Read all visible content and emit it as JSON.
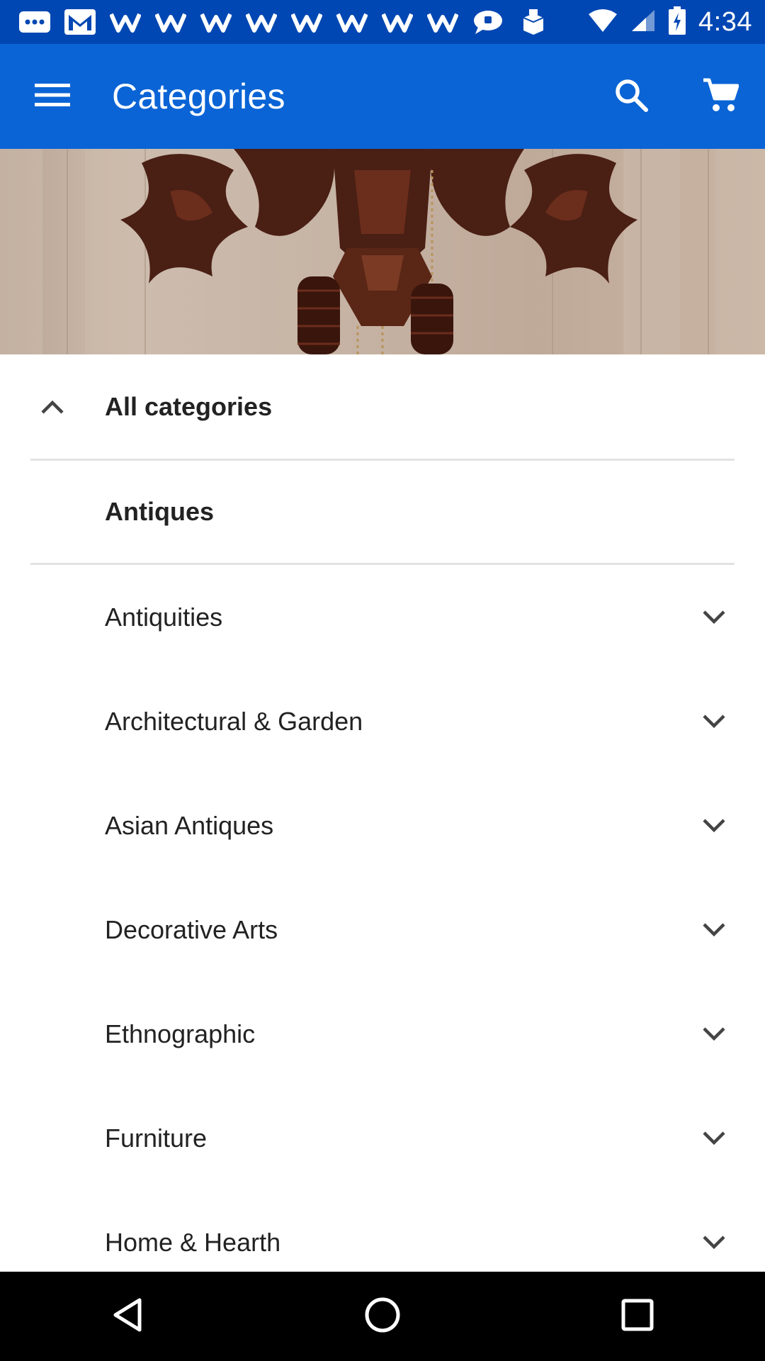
{
  "status_bar": {
    "time": "4:34",
    "icons": [
      "messages-icon",
      "gmail-icon",
      "app-w-icon",
      "app-w-icon",
      "app-w-icon",
      "app-w-icon",
      "app-w-icon",
      "app-w-icon",
      "app-w-icon",
      "app-w-icon",
      "chat-bubble-icon",
      "box-icon",
      "wifi-icon",
      "cell-signal-icon",
      "battery-charging-icon"
    ]
  },
  "app_bar": {
    "title": "Categories",
    "menu_icon": "hamburger-menu-icon",
    "search_icon": "search-icon",
    "cart_icon": "shopping-cart-icon"
  },
  "hero": {
    "description_icon": "cuckoo-clock-image"
  },
  "list": {
    "all_categories": "All categories",
    "selected": "Antiques",
    "items": [
      {
        "label": "Antiquities"
      },
      {
        "label": "Architectural & Garden"
      },
      {
        "label": "Asian Antiques"
      },
      {
        "label": "Decorative Arts"
      },
      {
        "label": "Ethnographic"
      },
      {
        "label": "Furniture"
      },
      {
        "label": "Home & Hearth"
      }
    ]
  },
  "nav_bar": {
    "back": "back-icon",
    "home": "home-icon",
    "recents": "recents-icon"
  },
  "colors": {
    "status_bar": "#0047b3",
    "app_bar": "#0a64d6",
    "text": "#222222",
    "divider": "#e2e2e2"
  }
}
